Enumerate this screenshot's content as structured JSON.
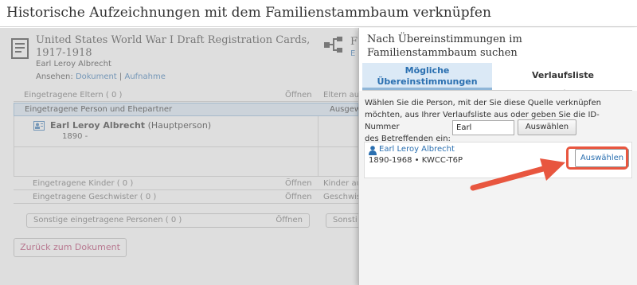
{
  "header": {
    "title": "Historische Aufzeichnungen mit dem Familienstammbaum verknüpfen"
  },
  "source": {
    "title": "United States World War I Draft Registration Cards, 1917-1918",
    "person": "Earl Leroy Albrecht",
    "view_label": "Ansehen:",
    "view_document": "Dokument",
    "view_separator": "|",
    "view_image": "Aufnahme",
    "tree_title_partial": "F",
    "tree_link_partial": "E"
  },
  "rows": {
    "parents_label": "Eingetragene Eltern ( 0 )",
    "parents_open": "Öffnen",
    "parents_right": "Eltern au",
    "spouse_label": "Eingetragene Person und Ehepartner",
    "spouse_right": "Ausgew",
    "children_label": "Eingetragene Kinder ( 0 )",
    "children_open": "Öffnen",
    "children_right": "Kinder au",
    "siblings_label": "Eingetragene Geschwister ( 0 )",
    "siblings_open": "Öffnen",
    "siblings_right": "Geschwis",
    "other_label": "Sonstige eingetragene Personen ( 0 )",
    "other_open": "Öffnen",
    "other_right": "Sonsti"
  },
  "person": {
    "name": "Earl Leroy Albrecht",
    "role": "(Hauptperson)",
    "years": "1890 -"
  },
  "back_button": "Zurück zum Dokument",
  "panel": {
    "title": "Nach Übereinstimmungen im Familienstammbaum suchen",
    "tab_matches": "Mögliche Übereinstimmungen",
    "tab_history": "Verlaufsliste",
    "instructions_1": "Wählen Sie die Person, mit der Sie diese Quelle verknüpfen",
    "instructions_2": "möchten, aus Ihrer Verlaufsliste aus oder geben Sie die ID-Nummer",
    "instructions_3": "des Betreffenden ein:",
    "id_value": "Earl",
    "select_button": "Auswählen",
    "result_name": "Earl Leroy Albrecht",
    "result_meta": "1890-1968 • KWCC-T6P",
    "result_button": "Auswählen"
  },
  "colors": {
    "accent": "#2a6fb0",
    "highlight": "#e8563f",
    "back_text": "#b03060"
  }
}
